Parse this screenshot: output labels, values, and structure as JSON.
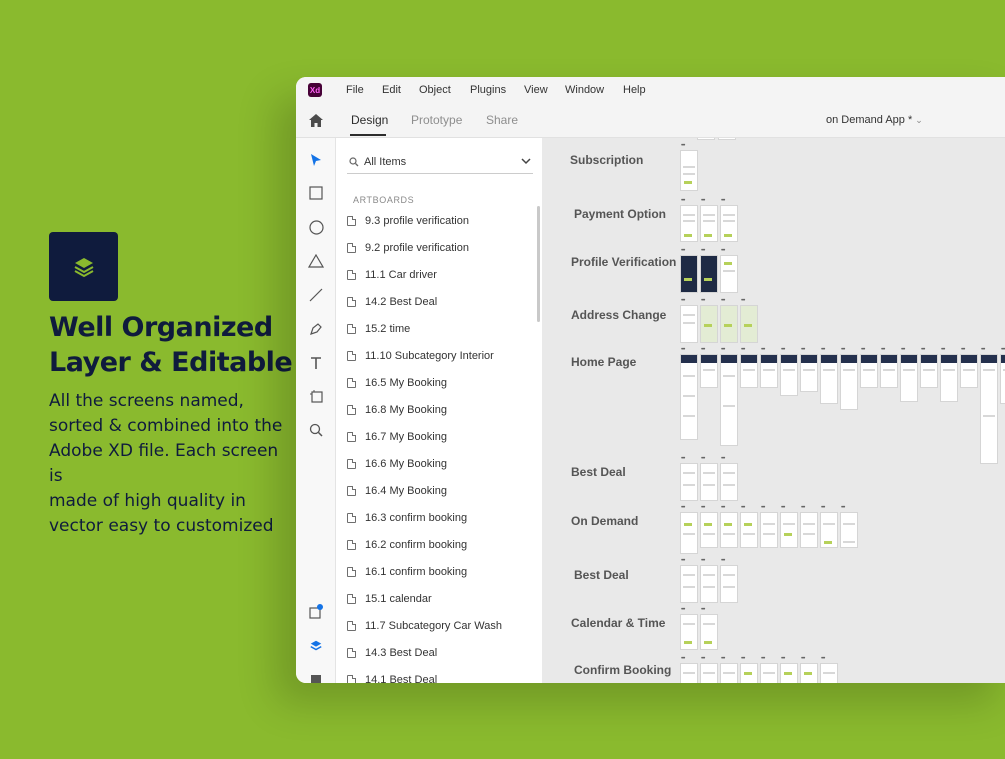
{
  "promo": {
    "title_line1": "Well Organized",
    "title_line2": "Layer & Editable",
    "desc_line1": "All the screens named,",
    "desc_line2": "sorted & combined into the",
    "desc_line3": "Adobe XD file. Each screen is",
    "desc_line4": "made of high quality in",
    "desc_line5": "vector easy to customized",
    "logo_color": "#0f1b3d",
    "accent_color": "#8aba2e"
  },
  "app": {
    "logo_text": "Xd",
    "menu": [
      "File",
      "Edit",
      "Object",
      "Plugins",
      "View",
      "Window",
      "Help"
    ],
    "tabs": [
      "Design",
      "Prototype",
      "Share"
    ],
    "active_tab": "Design",
    "doc_title": "on Demand App *"
  },
  "layers": {
    "filter": "All Items",
    "section": "ARTBOARDS",
    "items": [
      "9.3 profile verification",
      "9.2 profile verification",
      "11.1 Car driver",
      "14.2 Best Deal",
      "15.2 time",
      "11.10 Subcategory Interior",
      "16.5 My Booking",
      "16.8 My Booking",
      "16.7 My Booking",
      "16.6 My Booking",
      "16.4 My Booking",
      "16.3 confirm booking",
      "16.2 confirm booking",
      "16.1 confirm booking",
      "15.1 calendar",
      "11.7 Subcategory Car Wash",
      "14.3 Best Deal",
      "14.1 Best Deal"
    ]
  },
  "canvas": {
    "groups": [
      "Subscription",
      "Payment Option",
      "Profile Verification",
      "Address Change",
      "Home Page",
      "Best Deal",
      "On Demand",
      "Best Deal",
      "Calendar & Time",
      "Confirm Booking"
    ]
  }
}
